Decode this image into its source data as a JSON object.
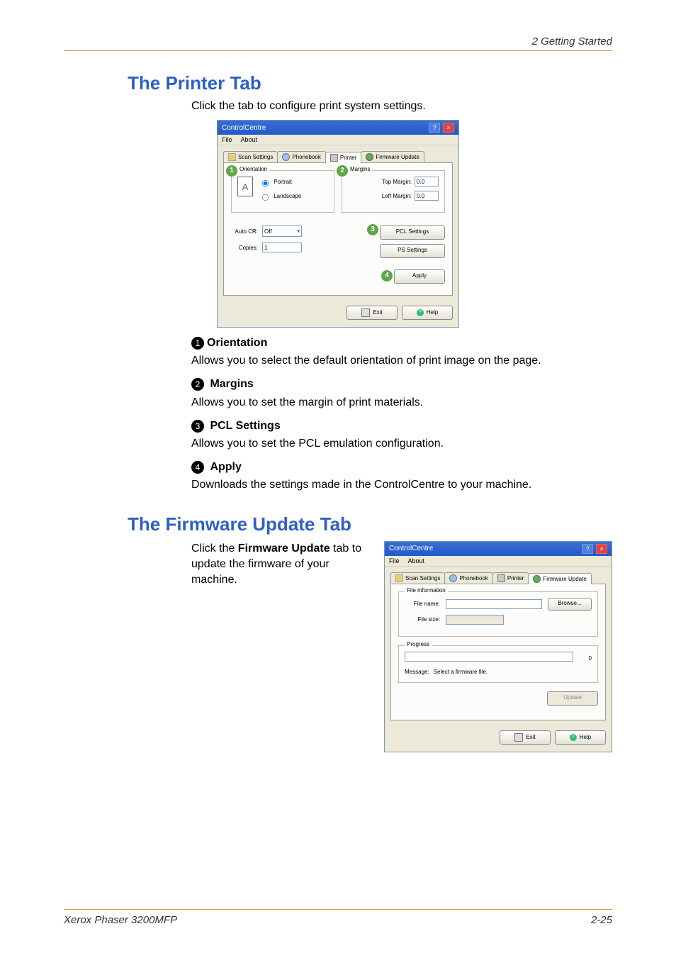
{
  "header": {
    "chapter": "2  Getting Started"
  },
  "section_printer": {
    "heading": "The Printer Tab",
    "intro": "Click the tab to configure print system settings.",
    "items": [
      {
        "num": "1",
        "title": "Orientation",
        "desc": "Allows you to select the default orientation of print image on the page."
      },
      {
        "num": "2",
        "title": "Margins",
        "desc": "Allows you to set the margin of print materials."
      },
      {
        "num": "3",
        "title": "PCL Settings",
        "desc": "Allows you to set the PCL emulation configuration."
      },
      {
        "num": "4",
        "title": "Apply",
        "desc": "Downloads the settings made in the ControlCentre to your machine."
      }
    ]
  },
  "section_firmware": {
    "heading": "The Firmware Update Tab",
    "intro_html_prefix": "Click the ",
    "intro_bold": "Firmware Update",
    "intro_html_suffix": " tab to update the firmware of your machine."
  },
  "app": {
    "title": "ControlCentre",
    "menu": {
      "file": "File",
      "about": "About"
    },
    "tabs": {
      "scan": "Scan Settings",
      "phone": "Phonebook",
      "printer": "Printer",
      "fw": "Firmware Update"
    },
    "buttons": {
      "exit": "Exit",
      "help": "Help",
      "apply": "Apply",
      "browse": "Browse...",
      "update": "Update",
      "pcl": "PCL Settings",
      "ps": "PS Settings"
    }
  },
  "printer_panel": {
    "orientation": {
      "legend": "Orientation",
      "portrait": "Portrait",
      "landscape": "Landscape",
      "icon": "A"
    },
    "margins": {
      "legend": "Margins",
      "top_label": "Top Margin:",
      "top_val": "0.0",
      "left_label": "Left Margin:",
      "left_val": "0.0"
    },
    "autocr": {
      "label": "Auto CR:",
      "value": "Off"
    },
    "copies": {
      "label": "Copies:",
      "value": "1"
    }
  },
  "firmware_panel": {
    "file_info": {
      "legend": "File information",
      "name_label": "File name:",
      "size_label": "File size:"
    },
    "progress": {
      "legend": "Progress",
      "percent": "0",
      "msg_label": "Message:",
      "msg_value": "Select a firmware file."
    }
  },
  "footer": {
    "left": "Xerox Phaser 3200MFP",
    "right": "2-25"
  }
}
